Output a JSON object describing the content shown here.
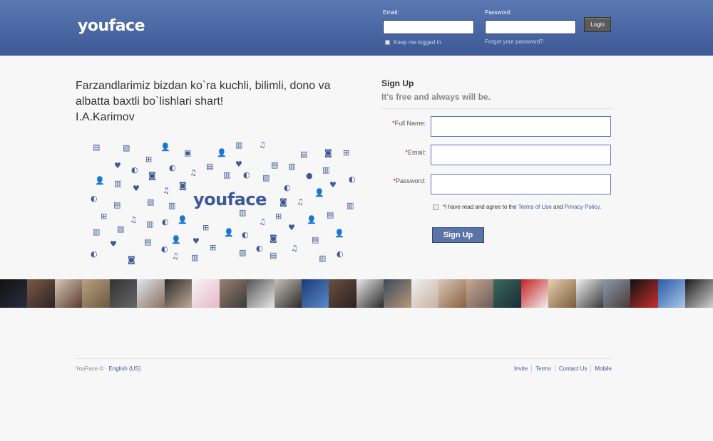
{
  "header": {
    "logo": "youface",
    "email_label": "Email:",
    "password_label": "Password:",
    "login_label": "Login",
    "keep_logged_in": "Keep me logged in",
    "forgot_password": "Forgot your password?"
  },
  "quote": {
    "line1": "Farzandlarimiz bizdan ko`ra kuchli, bilimli, dono va albatta baxtli bo`lishlari shart!",
    "author": "I.A.Karimov"
  },
  "cloud": {
    "logo": "youface"
  },
  "signup": {
    "title": "Sign Up",
    "subtitle": "It's free and always will be.",
    "full_name_label": "Full Name:",
    "email_label": "Email:",
    "password_label": "Password:",
    "required_mark": "*",
    "agree_prefix": "*I have read and agree to the ",
    "terms_link": "Terms of Use",
    "agree_and": " and ",
    "privacy_link": "Privacy Policy",
    "agree_suffix": ".",
    "button_label": "Sign Up"
  },
  "footer": {
    "copyright": "YouFace © · ",
    "language": "English (US)",
    "links": [
      "Invite",
      "Terms",
      "Contact Us",
      "Mobile"
    ]
  },
  "colors": {
    "brand": "#3d5a98",
    "header_top": "#5a78b0",
    "link": "#3b5998"
  }
}
